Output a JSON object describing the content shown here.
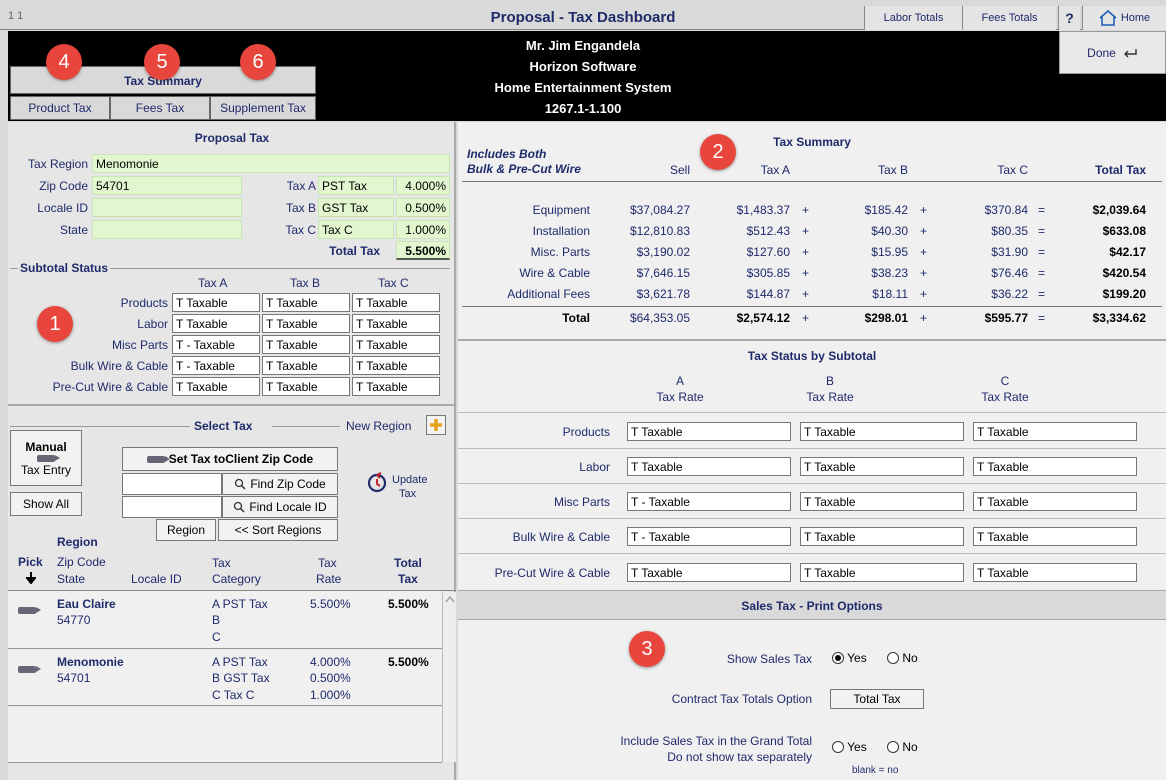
{
  "title_bar": {
    "record": "1   1",
    "title": "Proposal - Tax Dashboard",
    "labor_totals": "Labor Totals",
    "fees_totals": "Fees Totals",
    "help": "?",
    "home": "Home"
  },
  "header": {
    "client": "Mr. Jim Engandela",
    "company": "Horizon Software",
    "system": "Home Entertainment System",
    "proposal_no": "1267.1-1.100",
    "done": "Done"
  },
  "tax_summary_tabs": {
    "heading": "Tax Summary",
    "product_tax": "Product Tax",
    "fees_tax": "Fees Tax",
    "supplement_tax": "Supplement Tax"
  },
  "badges": [
    "1",
    "2",
    "3",
    "4",
    "5",
    "6"
  ],
  "proposal_tax": {
    "title": "Proposal Tax",
    "tax_region_label": "Tax Region",
    "tax_region": "Menomonie",
    "zip_label": "Zip Code",
    "zip": "54701",
    "locale_label": "Locale ID",
    "locale": "",
    "state_label": "State",
    "state": "",
    "tax_a_label": "Tax A",
    "tax_a_name": "PST Tax",
    "tax_a_rate": "4.000%",
    "tax_b_label": "Tax B",
    "tax_b_name": "GST Tax",
    "tax_b_rate": "0.500%",
    "tax_c_label": "Tax C",
    "tax_c_name": "Tax C",
    "tax_c_rate": "1.000%",
    "total_label": "Total Tax",
    "total_rate": "5.500%"
  },
  "subtotal_status": {
    "title": "Subtotal Status",
    "col_a": "Tax A",
    "col_b": "Tax B",
    "col_c": "Tax C",
    "rows": [
      {
        "label": "Products",
        "a": "T  Taxable",
        "b": "T  Taxable",
        "c": "T  Taxable"
      },
      {
        "label": "Labor",
        "a": "T  Taxable",
        "b": "T  Taxable",
        "c": "T  Taxable"
      },
      {
        "label": "Misc Parts",
        "a": "T - Taxable",
        "b": "T  Taxable",
        "c": "T  Taxable"
      },
      {
        "label": "Bulk Wire & Cable",
        "a": "T - Taxable",
        "b": "T  Taxable",
        "c": "T  Taxable"
      },
      {
        "label": "Pre-Cut Wire & Cable",
        "a": "T  Taxable",
        "b": "T  Taxable",
        "c": "T  Taxable"
      }
    ]
  },
  "select_tax": {
    "title": "Select Tax",
    "new_region": "New Region",
    "manual": "Manual",
    "tax_entry": "Tax Entry",
    "show_all": "Show All",
    "set_tax_prefix": "Set Tax to ",
    "set_tax_bold": "Client Zip Code",
    "find_zip": "Find Zip Code",
    "find_locale": "Find Locale ID",
    "region_btn": "Region",
    "sort_regions": "<< Sort Regions",
    "update": "Update",
    "update_tax": "Tax",
    "zip_input": "",
    "locale_input": ""
  },
  "region_list": {
    "col_pick": "Pick",
    "col_region": "Region",
    "col_zip": "Zip Code",
    "col_state": "State",
    "col_locale": "Locale ID",
    "col_tax": "Tax",
    "col_category": "Category",
    "col_taxrate1": "Tax",
    "col_taxrate2": "Rate",
    "col_total1": "Total",
    "col_total2": "Tax",
    "rows": [
      {
        "name": "Eau Claire",
        "zip": "54770",
        "a": "A  PST Tax",
        "a_rate": "5.500%",
        "b": "B",
        "b_rate": "",
        "c": "C",
        "c_rate": "",
        "total": "5.500%"
      },
      {
        "name": "Menomonie",
        "zip": "54701",
        "a": "A  PST Tax",
        "a_rate": "4.000%",
        "b": "B  GST Tax",
        "b_rate": "0.500%",
        "c": "C  Tax C",
        "c_rate": "1.000%",
        "total": "5.500%"
      }
    ]
  },
  "tax_summary": {
    "title": "Tax Summary",
    "includes1": "Includes Both",
    "includes2": "Bulk & Pre-Cut Wire",
    "col_sell": "Sell",
    "col_a": "Tax A",
    "col_b": "Tax B",
    "col_c": "Tax C",
    "col_total": "Total Tax",
    "rows": [
      {
        "label": "Equipment",
        "sell": "$37,084.27",
        "a": "$1,483.37",
        "b": "$185.42",
        "c": "$370.84",
        "total": "$2,039.64"
      },
      {
        "label": "Installation",
        "sell": "$12,810.83",
        "a": "$512.43",
        "b": "$40.30",
        "c": "$80.35",
        "total": "$633.08"
      },
      {
        "label": "Misc. Parts",
        "sell": "$3,190.02",
        "a": "$127.60",
        "b": "$15.95",
        "c": "$31.90",
        "total": "$42.17"
      },
      {
        "label": "Wire & Cable",
        "sell": "$7,646.15",
        "a": "$305.85",
        "b": "$38.23",
        "c": "$76.46",
        "total": "$420.54"
      },
      {
        "label": "Additional Fees",
        "sell": "$3,621.78",
        "a": "$144.87",
        "b": "$18.11",
        "c": "$36.22",
        "total": "$199.20"
      }
    ],
    "total_row": {
      "label": "Total",
      "sell": "$64,353.05",
      "a": "$2,574.12",
      "b": "$298.01",
      "c": "$595.77",
      "total": "$3,334.62"
    },
    "plus": "+",
    "equals": "="
  },
  "tax_status": {
    "title": "Tax Status by Subtotal",
    "col_a1": "A",
    "col_a2": "Tax Rate",
    "col_b1": "B",
    "col_b2": "Tax Rate",
    "col_c1": "C",
    "col_c2": "Tax Rate",
    "rows": [
      {
        "label": "Products",
        "a": "T  Taxable",
        "b": "T  Taxable",
        "c": "T  Taxable"
      },
      {
        "label": "Labor",
        "a": "T  Taxable",
        "b": "T  Taxable",
        "c": "T  Taxable"
      },
      {
        "label": "Misc Parts",
        "a": "T - Taxable",
        "b": "T  Taxable",
        "c": "T  Taxable"
      },
      {
        "label": "Bulk Wire & Cable",
        "a": "T - Taxable",
        "b": "T  Taxable",
        "c": "T  Taxable"
      },
      {
        "label": "Pre-Cut Wire & Cable",
        "a": "T  Taxable",
        "b": "T  Taxable",
        "c": "T  Taxable"
      }
    ]
  },
  "print_options": {
    "title": "Sales Tax - Print Options",
    "show_sales_tax": "Show Sales Tax",
    "yes": "Yes",
    "no": "No",
    "contract_label": "Contract Tax Totals Option",
    "contract_value": "Total Tax",
    "include_label1": "Include Sales Tax in the Grand Total",
    "include_label2": "Do not show tax separately",
    "blank_note": "blank = no"
  },
  "colors": {
    "accent": "#1f2a6b",
    "badge": "#e8453c",
    "green_field": "#e2f7cf"
  }
}
